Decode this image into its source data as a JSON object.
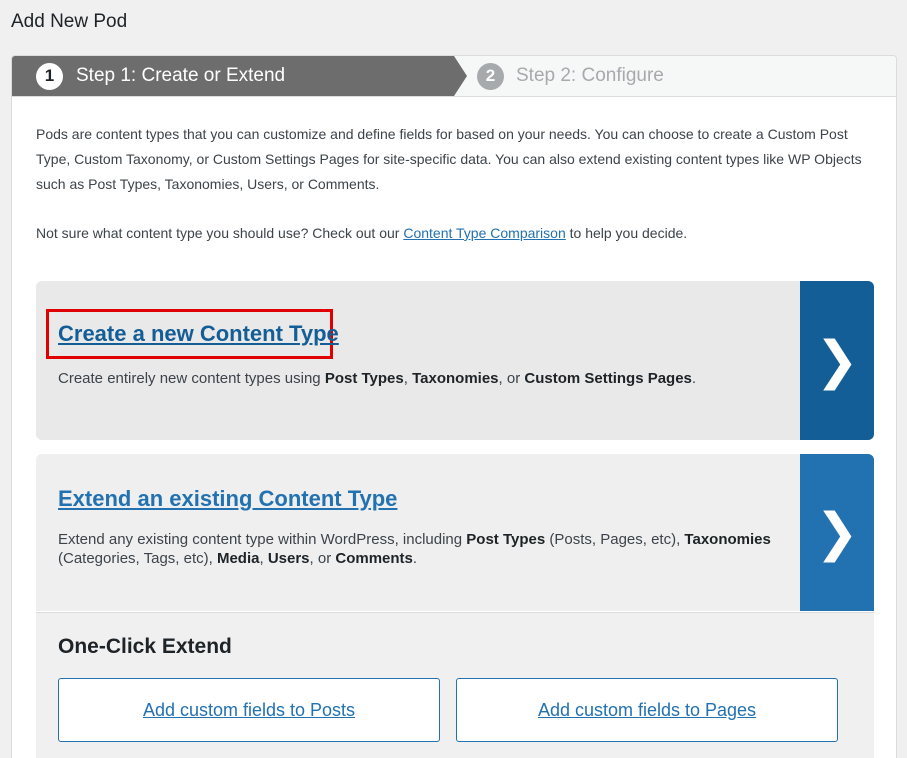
{
  "page": {
    "title": "Add New Pod"
  },
  "steps": [
    {
      "number": "1",
      "label": "Step 1: Create or Extend",
      "active": true
    },
    {
      "number": "2",
      "label": "Step 2: Configure",
      "active": false
    }
  ],
  "intro": {
    "paragraph": "Pods are content types that you can customize and define fields for based on your needs. You can choose to create a Custom Post Type, Custom Taxonomy, or Custom Settings Pages for site-specific data. You can also extend existing content types like WP Objects such as Post Types, Taxonomies, Users, or Comments.",
    "help_prefix": "Not sure what content type you should use? Check out our ",
    "help_link": "Content Type Comparison",
    "help_suffix": " to help you decide."
  },
  "create_card": {
    "title": "Create a new Content Type",
    "desc_prefix": "Create entirely new content types using ",
    "desc_b1": "Post Types",
    "desc_sep1": ", ",
    "desc_b2": "Taxonomies",
    "desc_sep2": ", or ",
    "desc_b3": "Custom Settings Pages",
    "desc_suffix": ".",
    "arrow": "❯"
  },
  "extend_card": {
    "title": "Extend an existing Content Type",
    "desc_prefix": "Extend any existing content type within WordPress, including ",
    "desc_b1": "Post Types",
    "desc_t1": " (Posts, Pages, etc), ",
    "desc_b2": "Taxonomies",
    "desc_t2": " (Categories, Tags, etc), ",
    "desc_b3": "Media",
    "desc_t3": ", ",
    "desc_b4": "Users",
    "desc_t4": ", or ",
    "desc_b5": "Comments",
    "desc_suffix": ".",
    "arrow": "❯"
  },
  "one_click": {
    "title": "One-Click Extend",
    "buttons": [
      {
        "label": "Add custom fields to Posts"
      },
      {
        "label": "Add custom fields to Pages"
      }
    ]
  },
  "colors": {
    "highlight": "#e00000",
    "link": "#2271b1",
    "arrow_dark": "#135e96",
    "arrow_light": "#2271b1"
  }
}
